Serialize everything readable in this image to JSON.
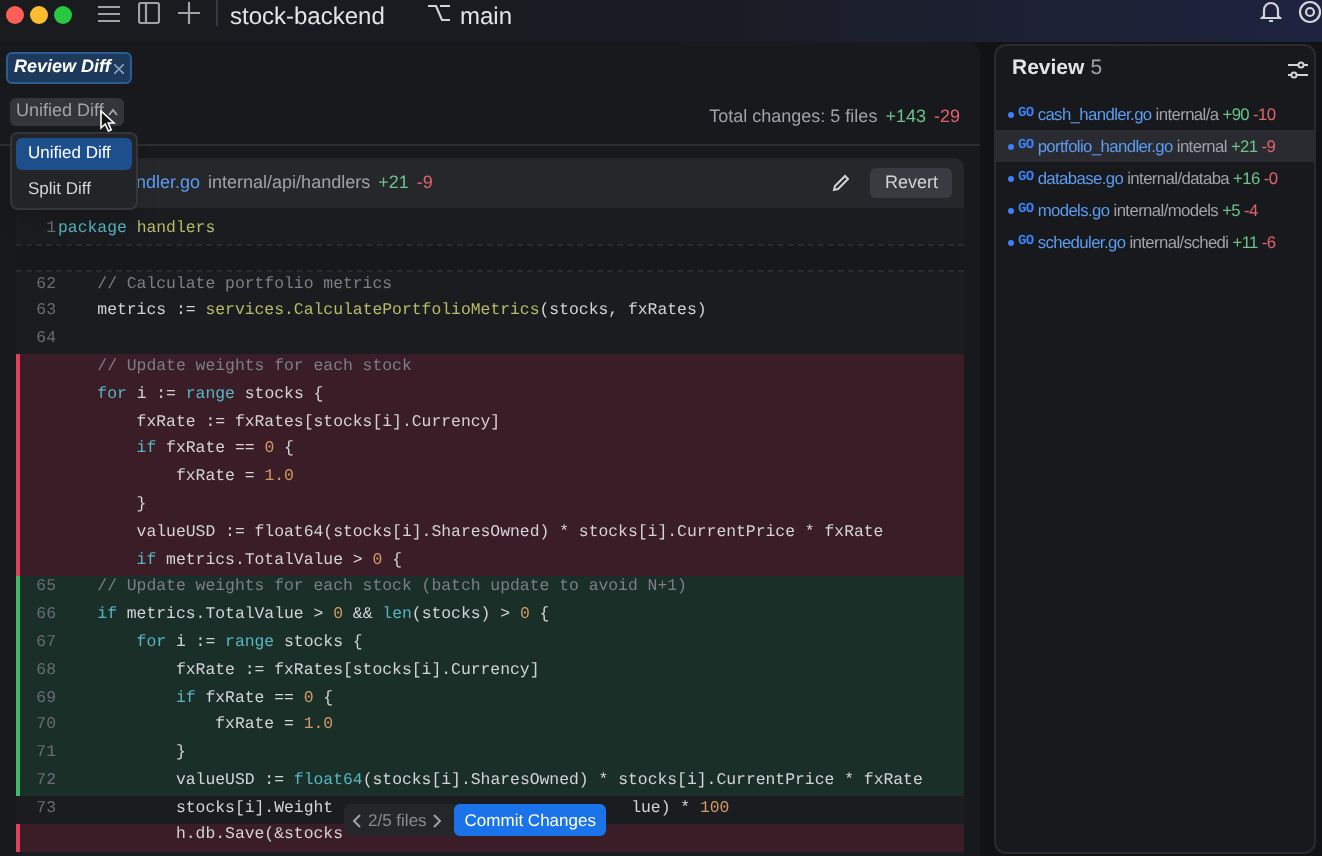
{
  "titlebar": {
    "project": "stock-backend",
    "branch": "main"
  },
  "tabs": [
    {
      "label": "Review Diff",
      "selected": true
    }
  ],
  "view_dropdown": {
    "label": "Unified Diff",
    "open": true,
    "options": [
      {
        "label": "Unified Diff",
        "selected": true
      },
      {
        "label": "Split Diff",
        "selected": false
      }
    ]
  },
  "summary": {
    "text": "Total changes: 5 files",
    "added": "+143",
    "removed": "-29"
  },
  "file": {
    "name": "ndler.go",
    "path": "internal/api/handlers",
    "added": "+21",
    "removed": "-9",
    "revert": "Revert",
    "top_lines": [
      {
        "number": "1",
        "tokens": [
          {
            "text": "package",
            "kind": "kw"
          },
          {
            "text": " handlers",
            "kind": "pkg"
          }
        ]
      }
    ],
    "lines": [
      {
        "kind": "context",
        "number": "62",
        "tokens": [
          {
            "text": "    // Calculate portfolio metrics",
            "kind": "comment"
          }
        ]
      },
      {
        "kind": "context",
        "number": "63",
        "tokens": [
          {
            "text": "    metrics := ",
            "kind": "plain"
          },
          {
            "text": "services.CalculatePortfolioMetrics",
            "kind": "fn"
          },
          {
            "text": "(stocks, fxRates)",
            "kind": "plain"
          }
        ]
      },
      {
        "kind": "context",
        "number": "64"
      },
      {
        "kind": "removed",
        "tokens": [
          {
            "text": "    // Update weights for each stock",
            "kind": "comment"
          }
        ]
      },
      {
        "kind": "removed",
        "tokens": [
          {
            "text": "    for",
            "kind": "kw"
          },
          {
            "text": " i := ",
            "kind": "plain"
          },
          {
            "text": "range",
            "kind": "kw"
          },
          {
            "text": " stocks {",
            "kind": "plain"
          }
        ]
      },
      {
        "kind": "removed",
        "tokens": [
          {
            "text": "        fxRate := fxRates[stocks[i].Currency]",
            "kind": "plain"
          }
        ]
      },
      {
        "kind": "removed",
        "tokens": [
          {
            "text": "        if",
            "kind": "kw"
          },
          {
            "text": " fxRate == ",
            "kind": "plain"
          },
          {
            "text": "0",
            "kind": "num"
          },
          {
            "text": " {",
            "kind": "plain"
          }
        ]
      },
      {
        "kind": "removed",
        "tokens": [
          {
            "text": "            fxRate = ",
            "kind": "plain"
          },
          {
            "text": "1.0",
            "kind": "num"
          }
        ]
      },
      {
        "kind": "removed",
        "tokens": [
          {
            "text": "        }",
            "kind": "plain"
          }
        ]
      },
      {
        "kind": "removed",
        "tokens": [
          {
            "text": "        valueUSD := float64(stocks[i].SharesOwned) * stocks[i].CurrentPrice * fxRate",
            "kind": "plain"
          }
        ]
      },
      {
        "kind": "removed",
        "tokens": [
          {
            "text": "        if",
            "kind": "kw"
          },
          {
            "text": " metrics.TotalValue > ",
            "kind": "plain"
          },
          {
            "text": "0",
            "kind": "num"
          },
          {
            "text": " {",
            "kind": "plain"
          }
        ]
      },
      {
        "kind": "added",
        "number": "65",
        "tokens": [
          {
            "text": "    // Update weights for each stock (batch update to avoid N+1)",
            "kind": "comment"
          }
        ]
      },
      {
        "kind": "added",
        "number": "66",
        "tokens": [
          {
            "text": "    if",
            "kind": "kw"
          },
          {
            "text": " metrics.TotalValue > ",
            "kind": "plain"
          },
          {
            "text": "0",
            "kind": "num"
          },
          {
            "text": " && ",
            "kind": "plain"
          },
          {
            "text": "len",
            "kind": "kw"
          },
          {
            "text": "(stocks) > ",
            "kind": "plain"
          },
          {
            "text": "0",
            "kind": "num"
          },
          {
            "text": " {",
            "kind": "plain"
          }
        ]
      },
      {
        "kind": "added",
        "number": "67",
        "tokens": [
          {
            "text": "        for",
            "kind": "kw"
          },
          {
            "text": " i := ",
            "kind": "plain"
          },
          {
            "text": "range",
            "kind": "kw"
          },
          {
            "text": " stocks {",
            "kind": "plain"
          }
        ]
      },
      {
        "kind": "added",
        "number": "68",
        "tokens": [
          {
            "text": "            fxRate := fxRates[stocks[i].Currency]",
            "kind": "plain"
          }
        ]
      },
      {
        "kind": "added",
        "number": "69",
        "tokens": [
          {
            "text": "            if",
            "kind": "kw"
          },
          {
            "text": " fxRate == ",
            "kind": "plain"
          },
          {
            "text": "0",
            "kind": "num"
          },
          {
            "text": " {",
            "kind": "plain"
          }
        ]
      },
      {
        "kind": "added",
        "number": "70",
        "tokens": [
          {
            "text": "                fxRate = ",
            "kind": "plain"
          },
          {
            "text": "1.0",
            "kind": "num"
          }
        ]
      },
      {
        "kind": "added",
        "number": "71",
        "tokens": [
          {
            "text": "            }",
            "kind": "plain"
          }
        ]
      },
      {
        "kind": "added",
        "number": "72",
        "tokens": [
          {
            "text": "            valueUSD := ",
            "kind": "plain"
          },
          {
            "text": "float64",
            "kind": "kw"
          },
          {
            "text": "(stocks[i].SharesOwned) * stocks[i].CurrentPrice * fxRate",
            "kind": "plain"
          }
        ]
      },
      {
        "kind": "context",
        "number": "73",
        "tokens": [
          {
            "text": "            stocks[i].Weight",
            "kind": "plain"
          },
          {
            "text": "lue) * ",
            "kind": "tail"
          },
          {
            "text": "100",
            "kind": "num"
          }
        ]
      },
      {
        "kind": "removed",
        "tokens": [
          {
            "text": "            h.db.Save(&stocks",
            "kind": "plain"
          }
        ]
      }
    ]
  },
  "navigator": {
    "position": "2/5 files",
    "commit": "Commit Changes"
  },
  "review": {
    "title": "Review",
    "count": "5",
    "files": [
      {
        "badge": "GO",
        "name": "cash_handler.go",
        "path": "internal/a",
        "added": "+90",
        "removed": "-10",
        "selected": false
      },
      {
        "badge": "GO",
        "name": "portfolio_handler.go",
        "path": "internal",
        "added": "+21",
        "removed": "-9",
        "selected": true
      },
      {
        "badge": "GO",
        "name": "database.go",
        "path": "internal/databa",
        "added": "+16",
        "removed": "-0",
        "selected": false
      },
      {
        "badge": "GO",
        "name": "models.go",
        "path": "internal/models",
        "added": "+5",
        "removed": "-4",
        "selected": false
      },
      {
        "badge": "GO",
        "name": "scheduler.go",
        "path": "internal/schedi",
        "added": "+11",
        "removed": "-6",
        "selected": false
      }
    ]
  }
}
